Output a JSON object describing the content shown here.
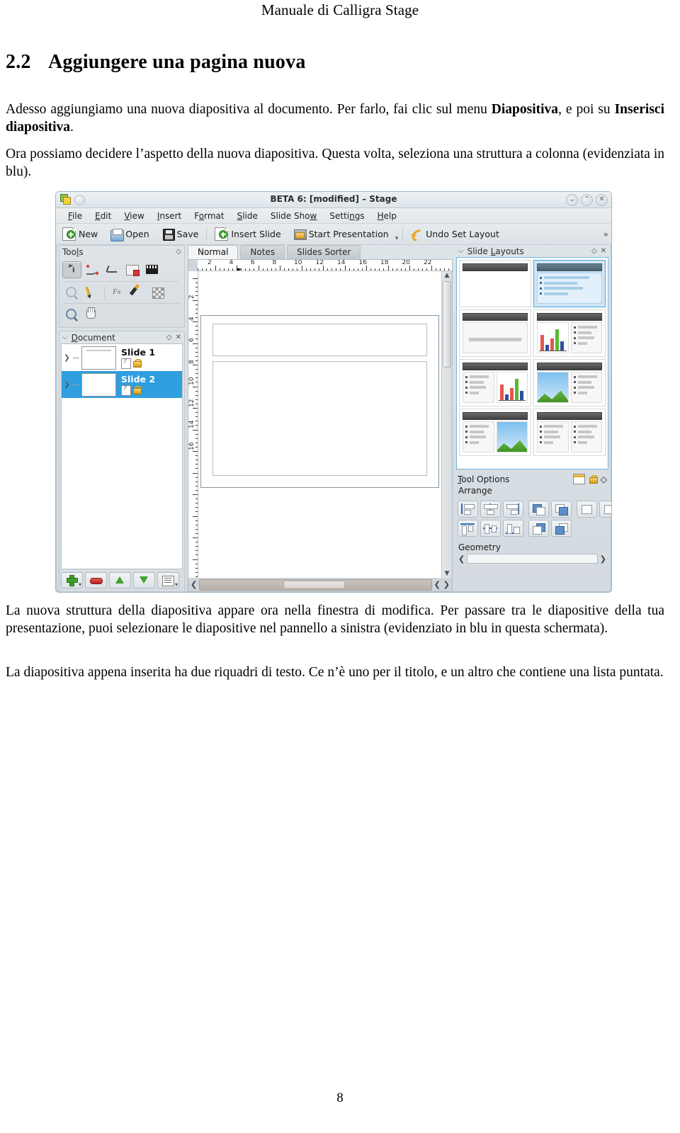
{
  "document": {
    "running_header": "Manuale di Calligra Stage",
    "section_number": "2.2",
    "section_title": "Aggiungere una pagina nuova",
    "paragraph_1_part1": "Adesso aggiungiamo una nuova diapositiva al documento.  Per farlo, fai clic sul menu ",
    "paragraph_1_bold1": "Diapositiva",
    "paragraph_1_part2": ", e poi su ",
    "paragraph_1_bold2": "Inserisci diapositiva",
    "paragraph_1_part3": ".",
    "paragraph_2": "Ora possiamo decidere l’aspetto della nuova diapositiva. Questa volta, seleziona una struttura a colonna (evidenziata in blu).",
    "paragraph_3": "La nuova struttura della diapositiva appare ora nella finestra di modifica.  Per passare tra le diapositive della tua presentazione, puoi selezionare le diapositive nel pannello a sinistra (evidenziato in blu in questa schermata).",
    "paragraph_4": "La diapositiva appena inserita ha due riquadri di testo.  Ce n’è uno per il titolo, e un altro che contiene una lista puntata.",
    "page_number": "8"
  },
  "app": {
    "title": "BETA 6:  [modified] – Stage",
    "window_buttons": [
      {
        "name": "shade-button",
        "glyph": "⌄"
      },
      {
        "name": "maximize-button",
        "glyph": "⌃"
      },
      {
        "name": "close-button",
        "glyph": "✕"
      }
    ],
    "menus": [
      {
        "pre": "",
        "accel": "F",
        "post": "ile"
      },
      {
        "pre": "",
        "accel": "E",
        "post": "dit"
      },
      {
        "pre": "",
        "accel": "V",
        "post": "iew"
      },
      {
        "pre": "",
        "accel": "I",
        "post": "nsert"
      },
      {
        "pre": "F",
        "accel": "o",
        "post": "rmat"
      },
      {
        "pre": "",
        "accel": "S",
        "post": "lide"
      },
      {
        "pre": "Slide Sho",
        "accel": "w",
        "post": ""
      },
      {
        "pre": "Setti",
        "accel": "n",
        "post": "gs"
      },
      {
        "pre": "",
        "accel": "H",
        "post": "elp"
      }
    ],
    "toolbar": [
      {
        "label": "New",
        "icon": "new-document-icon"
      },
      {
        "label": "Open",
        "icon": "open-folder-icon"
      },
      {
        "label": "Save",
        "icon": "floppy-disk-icon"
      },
      {
        "label": "Insert Slide",
        "icon": "insert-slide-icon"
      },
      {
        "label": "Start Presentation",
        "icon": "start-presentation-icon"
      },
      {
        "label": "Undo Set Layout",
        "icon": "undo-arrow-icon"
      }
    ],
    "toolbar_overflow": "»",
    "tools_panel": {
      "title_pre": "Too",
      "title_accel": "l",
      "title_post": "s",
      "tools": [
        "select-tool",
        "curve-tool",
        "line-tool",
        "image-tool",
        "video-tool",
        "pattern-tool",
        "pen-tool",
        "fx-tool",
        "brush-tool",
        "fill-tool",
        "zoom-tool",
        "pan-tool"
      ]
    },
    "document_panel": {
      "title_pre": "",
      "title_accel": "D",
      "title_post": "ocument",
      "slides": [
        {
          "name": "Slide 1",
          "selected": false
        },
        {
          "name": "Slide 2",
          "selected": true
        }
      ],
      "buttons": [
        "add-slide-button",
        "remove-slide-button",
        "move-up-button",
        "move-down-button",
        "list-options-button"
      ]
    },
    "view_tabs": [
      {
        "label": "Normal",
        "active": true
      },
      {
        "label": "Notes",
        "active": false
      },
      {
        "label": "Slides Sorter",
        "active": false
      }
    ],
    "ruler": {
      "horizontal_labels": [
        "2",
        "4",
        "6",
        "8",
        "10",
        "12",
        "14",
        "16",
        "18",
        "20",
        "22"
      ],
      "vertical_labels": [
        "2",
        "4",
        "6",
        "8",
        "10",
        "12",
        "14",
        "16"
      ]
    },
    "canvas": {
      "title_placeholder": "title-placeholder",
      "content_placeholder": "content-placeholder"
    },
    "slide_layouts_panel": {
      "title_pre": "Slide ",
      "title_accel": "L",
      "title_post": "ayouts",
      "layouts": [
        {
          "name": "title-only-layout",
          "kind": "blank",
          "selected": false
        },
        {
          "name": "title-bullets-layout",
          "kind": "bullets",
          "selected": true
        },
        {
          "name": "title-centered-text-layout",
          "kind": "bigline",
          "selected": false
        },
        {
          "name": "title-chart-bullets-layout",
          "kind": "chart-bullets",
          "selected": false
        },
        {
          "name": "title-bullets-chart-layout",
          "kind": "bullets-chart",
          "selected": false
        },
        {
          "name": "title-picture-bullets-layout",
          "kind": "picture-bullets",
          "selected": false
        },
        {
          "name": "title-bullets-picture-layout",
          "kind": "bullets-picture",
          "selected": false
        },
        {
          "name": "title-two-bullets-layout",
          "kind": "bullets-bullets",
          "selected": false
        }
      ]
    },
    "tool_options_panel": {
      "title_pre": "",
      "title_accel": "T",
      "title_post": "ool Options",
      "arrange_label": "Arrange",
      "geometry_label": "Geometry"
    }
  }
}
